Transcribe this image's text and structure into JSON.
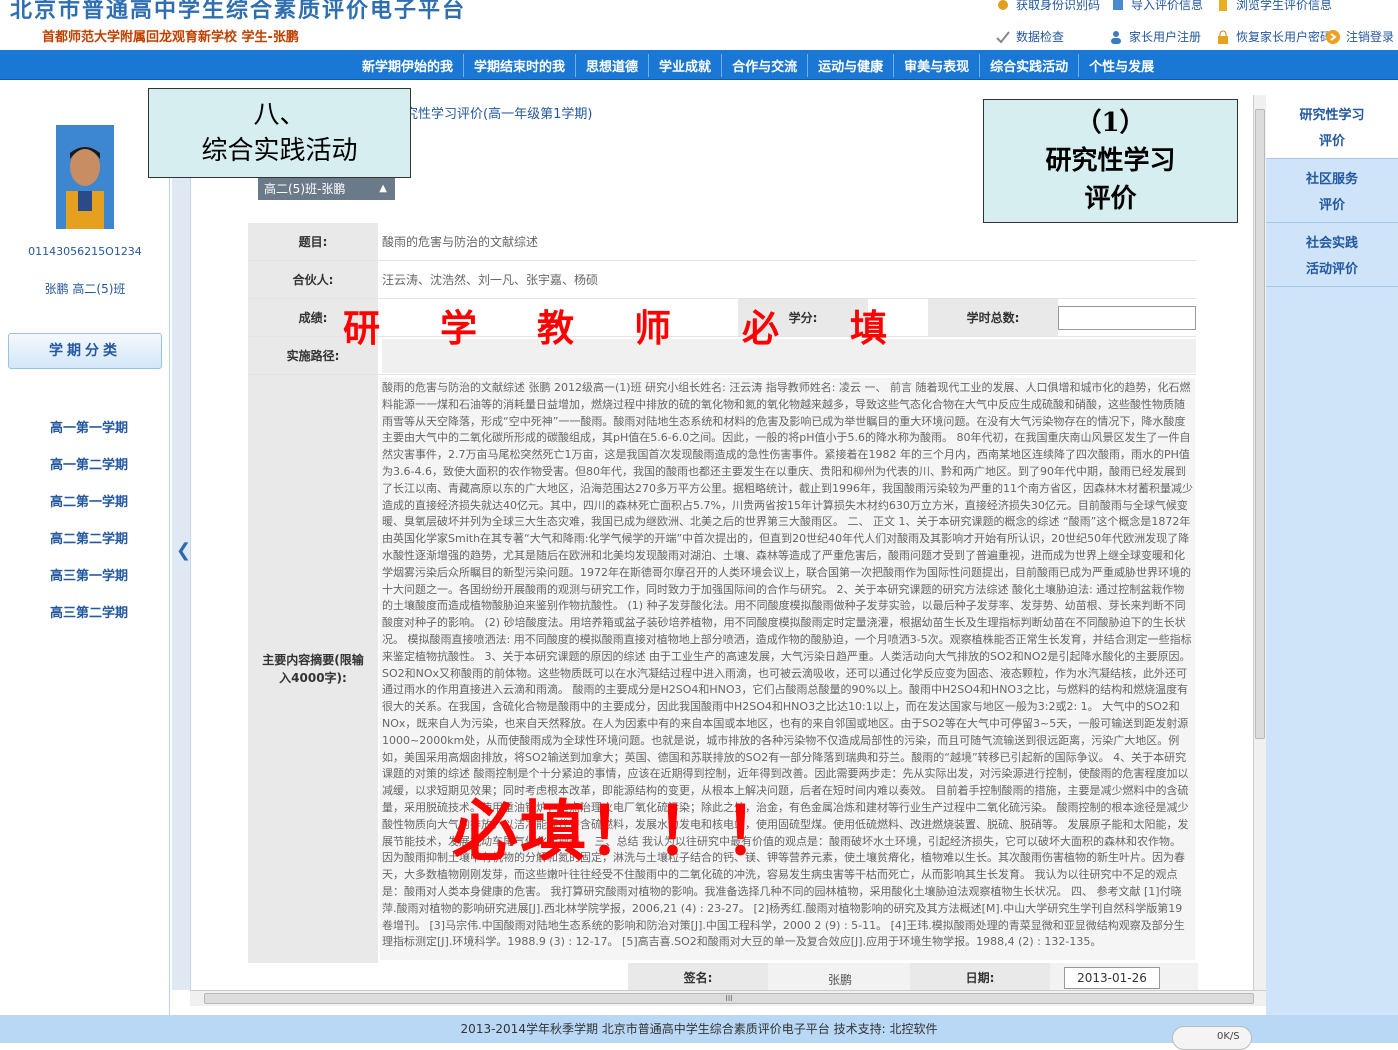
{
  "header": {
    "site_title": "北京市普通高中学生综合素质评价电子平台",
    "school_user": "首都师范大学附属回龙观育新学校 学生-张鹏",
    "links": [
      "获取身份识别码",
      "导入评价信息",
      "浏览学生评价信息",
      "数据检查",
      "家长用户注册",
      "恢复家长用户密码",
      "注销登录"
    ]
  },
  "nav": {
    "items": [
      "新学期伊始的我",
      "学期结束时的我",
      "思想道德",
      "学业成就",
      "合作与交流",
      "运动与健康",
      "审美与表现",
      "综合实践活动",
      "个性与发展"
    ]
  },
  "sidebar": {
    "student_id": "01143056215O1234",
    "student_name_class": "张鹏 高二(5)班",
    "term_header": "学期分类",
    "terms": [
      "高一第一学期",
      "高一第二学期",
      "高二第一学期",
      "高二第二学期",
      "高三第一学期",
      "高三第二学期"
    ]
  },
  "main": {
    "tab_caption": "究性学习评价(高一年级第1学期)",
    "class_selector": "高二(5)班-张鹏",
    "form": {
      "topic_label": "题目:",
      "topic_value": "酸雨的危害与防治的文献综述",
      "partners_label": "合伙人:",
      "partners_value": "汪云涛、沈浩然、刘一凡、张宇嘉、杨硕",
      "score_label": "成绩:",
      "credit_label": "学分:",
      "hours_label": "学时总数:",
      "path_label": "实施路径:",
      "abstract_label": "主要内容摘要(限输入4000字):",
      "abstract_text": "酸雨的危害与防治的文献综述 张鹏 2012级高一(1)班 研究小组长姓名: 汪云涛 指导教师姓名: 凌云 一、 前言 随着现代工业的发展、人口俱增和城市化的趋势，化石燃料能源一一煤和石油等的消耗量日益增加，燃烧过程中排放的硫的氧化物和氮的氧化物越来越多，导致这些气态化合物在大气中反应生成硫酸和硝酸，这些酸性物质随雨雪等从天空降落，形成“空中死神”一一酸雨。酸雨对陆地生态系统和材料的危害及影响已成为举世瞩目的重大环境问题。在没有大气污染物存在的情况下，降水酸度主要由大气中的二氧化碳所形成的碳酸组成，其pH值在5.6-6.0之间。因此，一般的将pH值小于5.6的降水称为酸雨。 80年代初，在我国重庆南山风景区发生了一件自然灾害事件，2.7万亩马尾松突然死亡1万亩，这是我国首次发现酸雨造成的急性伤害事件。紧接着在1982 年的三个月内，西南某地区连续降了四次酸雨，雨水的PH值为3.6-4.6，致使大面积的农作物受害。但80年代，我国的酸雨也都还主要发生在以重庆、贵阳和柳州为代表的川、黔和两广地区。到了90年代中期，酸雨已经发展到了长江以南、青藏高原以东的广大地区，沿海范围达270多万平方公里。据粗略统计，截止到1996年，我国酸雨污染较为严重的11个南方省区，因森林木材蓄积量减少造成的直接经济损失就达40亿元。其中，四川的森林死亡面积占5.7%，川贵两省按15年计算损失木材约630万立方米，直接经济损失30亿元。目前酸雨与全球气候变暖、臭氧层破坏并列为全球三大生态灾难，我国已成为继欧洲、北美之后的世界第三大酸雨区。 二、 正文 1、关于本研究课题的概念的综述 “酸雨”这个概念是1872年由英国化学家Smith在其专著“大气和降雨:化学气候学的开端”中首次提出的，但直到20世纪40年代人们对酸雨及其影响才开始有所认识，20世纪50年代欧洲发现了降水酸性逐渐增强的趋势，尤其是随后在欧洲和北美均发现酸雨对湖泊、土壤、森林等造成了严重危害后，酸雨问题才受到了普遍重视，进而成为世界上继全球变暖和化学烟雾污染后众所瞩目的新型污染问题。1972年在斯德哥尔摩召开的人类环境会议上，联合国第一次把酸雨作为国际性问题提出，目前酸雨已成为严重威胁世界环境的十大问题之一。各国纷纷开展酸雨的观测与研究工作，同时致力于加强国际间的合作与研究。 2、关于本研究课题的研究方法综述 酸化土壤胁迫法: 通过控制盆栽作物的土壤酸度而造成植物酸胁迫来鉴别作物抗酸性。 (1) 种子发芽酸化法。用不同酸度模拟酸雨做种子发芽实验，以最后种子发芽率、发芽势、幼苗根、芽长来判断不同酸度对种子的影响。 (2) 砂培酸度法。用培养箱或盆子装砂培养植物，用不同酸度模拟酸雨定时定量浇灌，根据幼苗生长及生理指标判断幼苗在不同酸胁迫下的生长状况。 模拟酸雨直接喷洒法: 用不同酸度的模拟酸雨直接对植物地上部分喷洒，造成作物的酸胁迫，一个月喷洒3-5次。观察植株能否正常生长发育，并结合测定一些指标来鉴定植物抗酸性。 3、关于本研究课题的原因的综述 由于工业生产的高速发展，大气污染日趋严重。人类活动向大气排放的SO2和NO2是引起降水酸化的主要原因。SO2和NOx又称酸雨的前体物。这些物质既可以在水汽凝结过程中进入雨滴，也可被云滴吸收，还可以通过化学反应变为固态、液态颗粒，作为水汽凝结核，此外还可通过雨水的作用直接进入云滴和雨滴。 酸雨的主要成分是H2SO4和HNO3，它们占酸雨总酸量的90%以上。酸雨中H2SO4和HNO3之比，与燃料的结构和燃烧温度有很大的关系。在我国，含硫化合物是酸雨中的主要成分，因此我国酸雨中H2SO4和HNO3之比达10:1以上，而在发达国家与地区一般为3:2或2: 1。 大气中的SO2和NOx，既来自人为污染，也来自天然释放。在人为因素中有的来自本国或本地区，也有的来自邻国或地区。由于SO2等在大气中可停留3~5天，一般可输送到距发射源1000~2000km处，从而使酸雨成为全球性环境问题。也就是说，城市排放的各种污染物不仅造成局部性的污染，而且可随气流输送到很远距离，污染广大地区。例如，美国采用高烟囱排放，将SO2输送到加拿大；英国、德国和苏联排放的SO2有一部分降落到瑞典和芬兰。酸雨的“越境”转移已引起新的国际争议。 4、关于本研究课题的对策的综述 酸雨控制是个十分紧迫的事情，应该在近期得到控制，近年得到改善。因此需要两步走：先从实际出发，对污染源进行控制，使酸雨的危害程度加以减缓，以求短期见效果；同时考虑根本改革，即能源结构的变更，从根本上解决问题，后者在短时间内难以奏效。 目前着手控制酸雨的措施，主要是减少燃料中的含硫量，采用脱硫技术。使用重油锅炉，重点治理火电厂氧化硫污染；除此之外，治金，有色金属冶炼和建材等行业生产过程中二氧化硫污染。 酸雨控制的根本途径是减少酸性物质向大气的排放。以洁净能源代替含硫燃料，发展水力发电和核电站，使用固硫型煤。使用低硫燃料、改进燃烧装置、脱硫、脱硝等。 发展原子能和太阳能，发展节能技术，发展机动车尾气催化转换器。 三、总结 我认为以往研究中最有价值的观点是：酸雨破坏水土环境，引起经济损失，它可以破坏大面积的森林和农作物。 因为酸雨抑制土壤中有机物的分解和氮的固定，淋洗与土壤粒子结合的钙、镁、钾等营养元素，使土壤贫瘠化，植物难以生长。其次酸雨伤害植物的新生叶片。因为春天，大多数植物刚刚发芽，而这些嫩叶往往经受不住酸雨中的二氧化硫的冲洗，容易发生病虫害等干枯而死亡，从而影响其生长发育。 我认为以往研究中不足的观点是：酸雨对人类本身健康的危害。 我打算研究酸雨对植物的影响。我准备选择几种不同的园林植物，采用酸化土壤胁迫法观察植物生长状况。 四、 参考文献 [1]付晓萍.酸雨对植物的影响研究进展[J].西北林学院学报，2006,21 (4) : 23-27。 [2]杨秀红.酸雨对植物影响的研究及其方法概述[M].中山大学研究生学刊自然科学版第19卷增刊。 [3]马宗伟.中国酸雨对陆地生态系统的影响和防治对策[J].中国工程科学，2000 2 (9) : 5-11。 [4]王玮.模拟酸雨处理的青菜显微和亚显微结构观察及部分生理指标测定[J].环境科学。1988.9 (3) : 12-17。 [5]高吉喜.SO2和酸雨对大豆的单一及复合效应[J].应用于环境生物学报。1988,4 (2) : 132-135。",
      "sign_label": "签名:",
      "sign_value": "张鹏",
      "date_label": "日期:",
      "date_value": "2013-01-26"
    }
  },
  "overlays": {
    "section": [
      "八、",
      "综合实践活动"
    ],
    "subsection": [
      "（1）",
      "研究性学习",
      "评价"
    ],
    "teacher_fill": [
      "研",
      "学",
      "教",
      "师",
      "必",
      "填"
    ],
    "must_fill": "必填！！！"
  },
  "right_tabs": [
    {
      "l1": "研究性学习",
      "l2": "评价"
    },
    {
      "l1": "社区服务",
      "l2": "评价"
    },
    {
      "l1": "社会实践",
      "l2": "活动评价"
    }
  ],
  "footer": {
    "text": "2013-2014学年秋季学期 北京市普通高中学生综合素质评价电子平台 技术支持: 北控软件",
    "badge": "0K/S"
  },
  "scroll": {
    "h_thumb_mark": "III"
  }
}
